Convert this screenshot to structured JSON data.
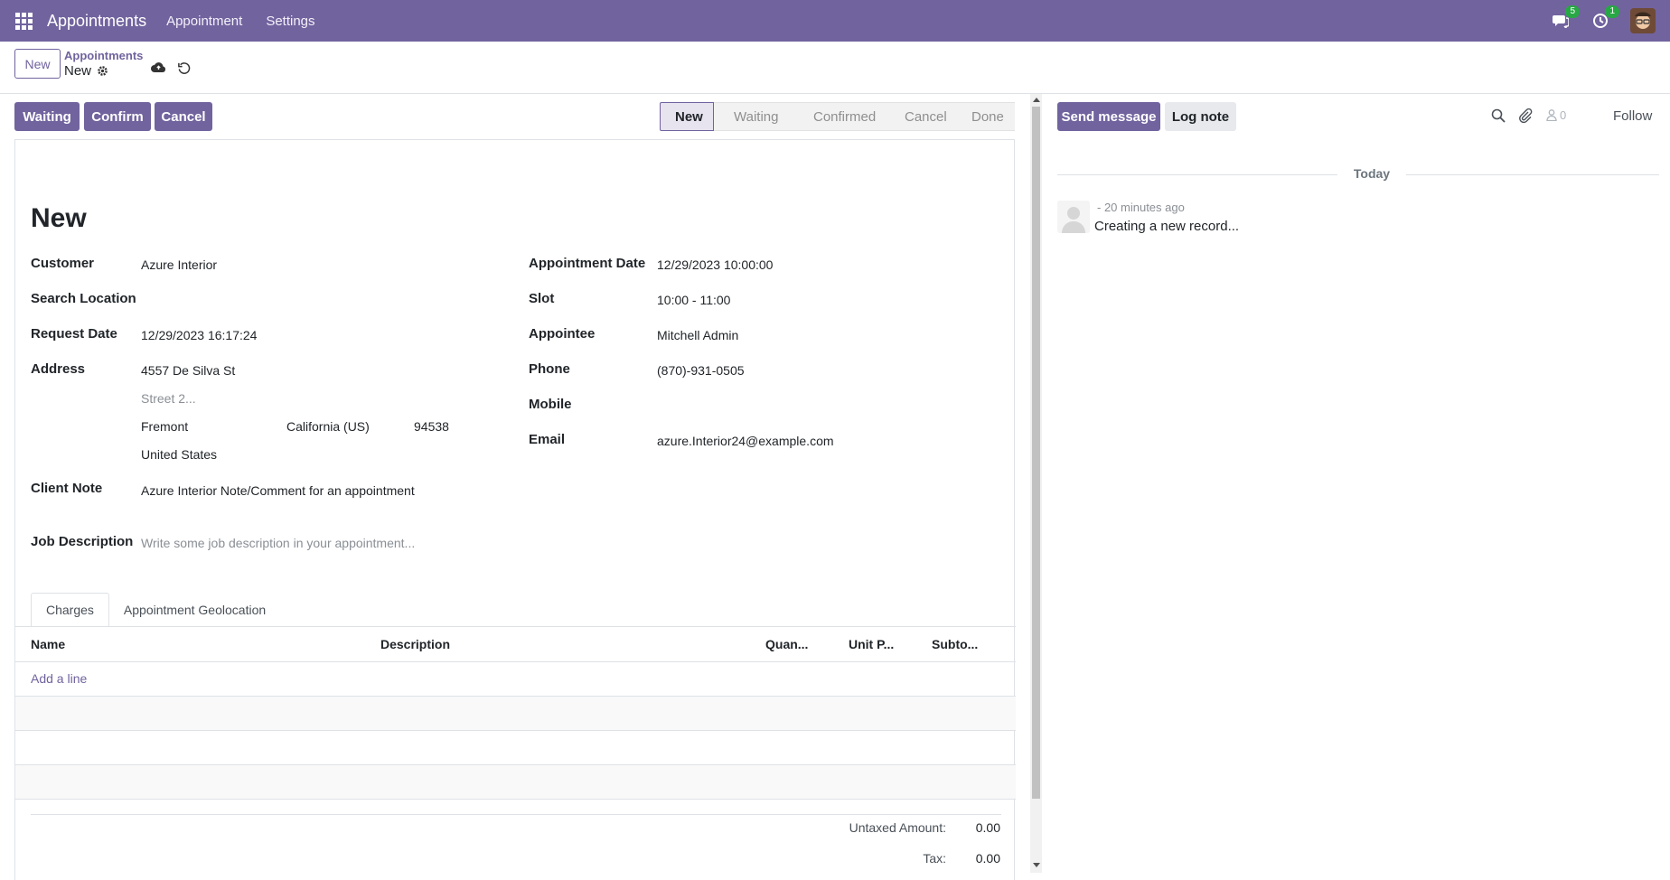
{
  "navbar": {
    "app_name": "Appointments",
    "menu": [
      "Appointment",
      "Settings"
    ],
    "messages_badge": "5",
    "activities_badge": "1",
    "colors": {
      "bar": "#71639e",
      "badge": "#28a745"
    }
  },
  "control": {
    "new_button": "New",
    "breadcrumb_parent": "Appointments",
    "breadcrumb_current": "New"
  },
  "actions": {
    "waiting": "Waiting",
    "confirm": "Confirm",
    "cancel": "Cancel"
  },
  "stages": [
    "New",
    "Waiting",
    "Confirmed",
    "Cancel",
    "Done"
  ],
  "active_stage": "New",
  "form": {
    "title": "New",
    "left": {
      "customer_label": "Customer",
      "customer_value": "Azure Interior",
      "search_location_label": "Search Location",
      "request_date_label": "Request Date",
      "request_date_value": "12/29/2023 16:17:24",
      "address_label": "Address",
      "street": "4557 De Silva St",
      "street2_placeholder": "Street 2...",
      "city": "Fremont",
      "state": "California (US)",
      "zip": "94538",
      "country": "United States",
      "client_note_label": "Client Note",
      "client_note_value": "Azure Interior Note/Comment for an appointment",
      "job_description_label": "Job Description",
      "job_description_placeholder": "Write some job description in your appointment..."
    },
    "right": {
      "appointment_date_label": "Appointment Date",
      "appointment_date_value": "12/29/2023 10:00:00",
      "slot_label": "Slot",
      "slot_value": "10:00 - 11:00",
      "appointee_label": "Appointee",
      "appointee_value": "Mitchell Admin",
      "phone_label": "Phone",
      "phone_value": "(870)-931-0505",
      "mobile_label": "Mobile",
      "email_label": "Email",
      "email_value": "azure.Interior24@example.com"
    }
  },
  "tabs": [
    "Charges",
    "Appointment Geolocation"
  ],
  "charges_table": {
    "columns": [
      "Name",
      "Description",
      "Quan...",
      "Unit P...",
      "Subto..."
    ],
    "add_line": "Add a line"
  },
  "totals": {
    "untaxed_label": "Untaxed Amount:",
    "untaxed_value": "0.00",
    "tax_label": "Tax:",
    "tax_value": "0.00"
  },
  "chatter": {
    "send_message": "Send message",
    "log_note": "Log note",
    "followers_count": "0",
    "follow": "Follow",
    "today": "Today",
    "message_time": "- 20 minutes ago",
    "message_body": "Creating a new record..."
  }
}
